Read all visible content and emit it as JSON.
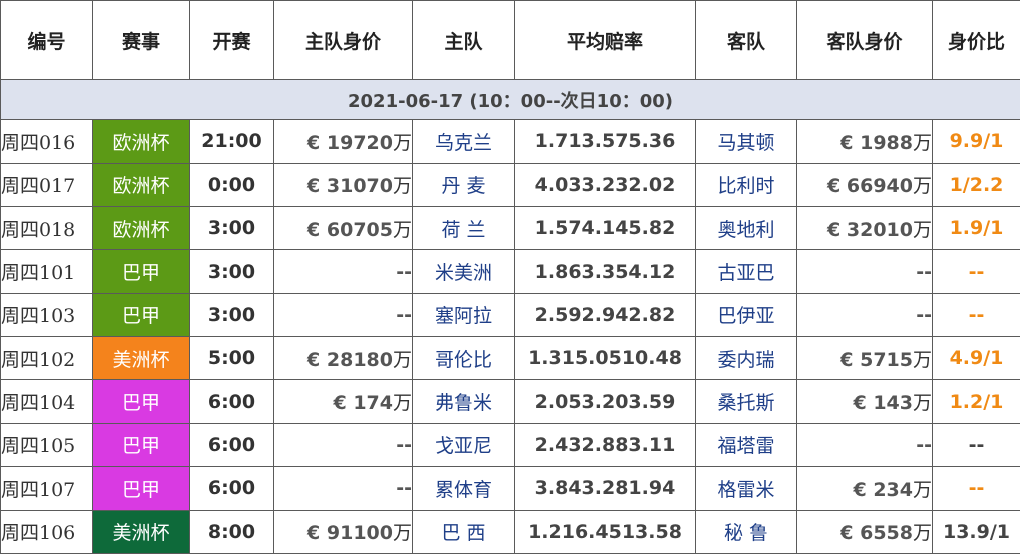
{
  "headers": [
    "编号",
    "赛事",
    "开赛",
    "主队身价",
    "主队",
    "平均赔率",
    "客队",
    "客队身价",
    "身价比"
  ],
  "date_range": "2021-06-17 (10：00--次日10：00)",
  "colors": {
    "euro_cup": "#5c9a16",
    "copa_america_orange": "#f4831c",
    "brazil_serie_green": "#5c9a16",
    "brazil_serie_magenta": "#d93ae2",
    "copa_america_dark": "#0e6a3a",
    "ratio_highlight": "#f08a14"
  },
  "rows": [
    {
      "no": "周四016",
      "league": "欧洲杯",
      "league_color": "#5c9a16",
      "time": "21:00",
      "home_value": "€ 19720",
      "home_unit": "万",
      "home": "乌克兰",
      "odds": "1.713.575.36",
      "away": "马其顿",
      "away_value": "€ 1988",
      "away_unit": "万",
      "ratio": "9.9/1",
      "ratio_style": "orange"
    },
    {
      "no": "周四017",
      "league": "欧洲杯",
      "league_color": "#5c9a16",
      "time": "0:00",
      "home_value": "€ 31070",
      "home_unit": "万",
      "home": "丹 麦",
      "odds": "4.033.232.02",
      "away": "比利时",
      "away_value": "€ 66940",
      "away_unit": "万",
      "ratio": "1/2.2",
      "ratio_style": "orange"
    },
    {
      "no": "周四018",
      "league": "欧洲杯",
      "league_color": "#5c9a16",
      "time": "3:00",
      "home_value": "€ 60705",
      "home_unit": "万",
      "home": "荷 兰",
      "odds": "1.574.145.82",
      "away": "奥地利",
      "away_value": "€ 32010",
      "away_unit": "万",
      "ratio": "1.9/1",
      "ratio_style": "orange"
    },
    {
      "no": "周四101",
      "league": "巴甲",
      "league_color": "#5c9a16",
      "time": "3:00",
      "home_value": "--",
      "home_unit": "",
      "home": "米美洲",
      "odds": "1.863.354.12",
      "away": "古亚巴",
      "away_value": "--",
      "away_unit": "",
      "ratio": "--",
      "ratio_style": "orange"
    },
    {
      "no": "周四103",
      "league": "巴甲",
      "league_color": "#5c9a16",
      "time": "3:00",
      "home_value": "--",
      "home_unit": "",
      "home": "塞阿拉",
      "odds": "2.592.942.82",
      "away": "巴伊亚",
      "away_value": "--",
      "away_unit": "",
      "ratio": "--",
      "ratio_style": "orange"
    },
    {
      "no": "周四102",
      "league": "美洲杯",
      "league_color": "#f4831c",
      "time": "5:00",
      "home_value": "€ 28180",
      "home_unit": "万",
      "home": "哥伦比",
      "odds": "1.315.0510.48",
      "away": "委内瑞",
      "away_value": "€ 5715",
      "away_unit": "万",
      "ratio": "4.9/1",
      "ratio_style": "orange"
    },
    {
      "no": "周四104",
      "league": "巴甲",
      "league_color": "#d93ae2",
      "time": "6:00",
      "home_value": "€ 174",
      "home_unit": "万",
      "home": "弗鲁米",
      "odds": "2.053.203.59",
      "away": "桑托斯",
      "away_value": "€ 143",
      "away_unit": "万",
      "ratio": "1.2/1",
      "ratio_style": "orange"
    },
    {
      "no": "周四105",
      "league": "巴甲",
      "league_color": "#d93ae2",
      "time": "6:00",
      "home_value": "--",
      "home_unit": "",
      "home": "戈亚尼",
      "odds": "2.432.883.11",
      "away": "福塔雷",
      "away_value": "--",
      "away_unit": "",
      "ratio": "--",
      "ratio_style": "dark"
    },
    {
      "no": "周四107",
      "league": "巴甲",
      "league_color": "#d93ae2",
      "time": "6:00",
      "home_value": "--",
      "home_unit": "",
      "home": "累体育",
      "odds": "3.843.281.94",
      "away": "格雷米",
      "away_value": "€ 234",
      "away_unit": "万",
      "ratio": "--",
      "ratio_style": "orange"
    },
    {
      "no": "周四106",
      "league": "美洲杯",
      "league_color": "#0e6a3a",
      "time": "8:00",
      "home_value": "€ 91100",
      "home_unit": "万",
      "home": "巴 西",
      "odds": "1.216.4513.58",
      "away": "秘 鲁",
      "away_value": "€ 6558",
      "away_unit": "万",
      "ratio": "13.9/1",
      "ratio_style": "dark"
    }
  ]
}
